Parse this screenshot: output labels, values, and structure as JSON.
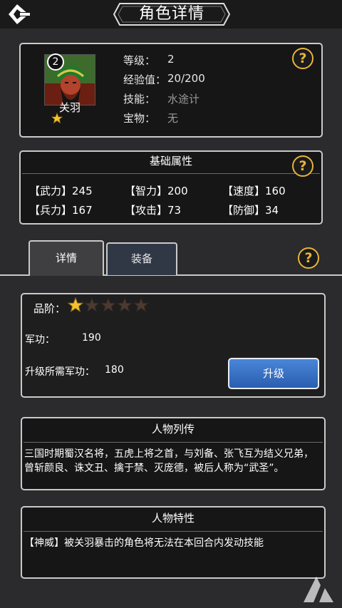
{
  "header": {
    "title": "角色详情"
  },
  "hero": {
    "level_badge": "2",
    "name": "关羽",
    "info": [
      {
        "label": "等级：",
        "value": "2"
      },
      {
        "label": "经验值：",
        "value": "20/200"
      },
      {
        "label": "技能：",
        "value": "水途计"
      },
      {
        "label": "宝物：",
        "value": "无"
      }
    ]
  },
  "attributes": {
    "title": "基础属性",
    "items": [
      {
        "text": "【武力】245"
      },
      {
        "text": "【智力】200"
      },
      {
        "text": "【速度】160"
      },
      {
        "text": "【兵力】167"
      },
      {
        "text": "【攻击】73"
      },
      {
        "text": "【防御】34"
      }
    ]
  },
  "tabs": [
    {
      "label": "详情",
      "active": true
    },
    {
      "label": "装备",
      "active": false
    }
  ],
  "detail": {
    "grade_label": "品阶：",
    "grade_stars": 1,
    "grade_stars_max": 5,
    "merit_label": "军功：",
    "merit_value": "190",
    "upgrade_need_label": "升级所需军功：",
    "upgrade_need_value": "180",
    "upgrade_button": "升级"
  },
  "biography": {
    "title": "人物列传",
    "text": "三国时期蜀汉名将，五虎上将之首，与刘备、张飞互为结义兄弟，曾斩颜良、诛文丑、擒于禁、灭庞德，被后人称为“武圣”。"
  },
  "trait": {
    "title": "人物特性",
    "text": "【神威】被关羽暴击的角色将无法在本回合内发动技能"
  },
  "colors": {
    "accent_gold": "#e8b43a",
    "button_blue": "#3a74c8",
    "panel_bg": "#161617",
    "page_bg": "#2b2b2d"
  }
}
